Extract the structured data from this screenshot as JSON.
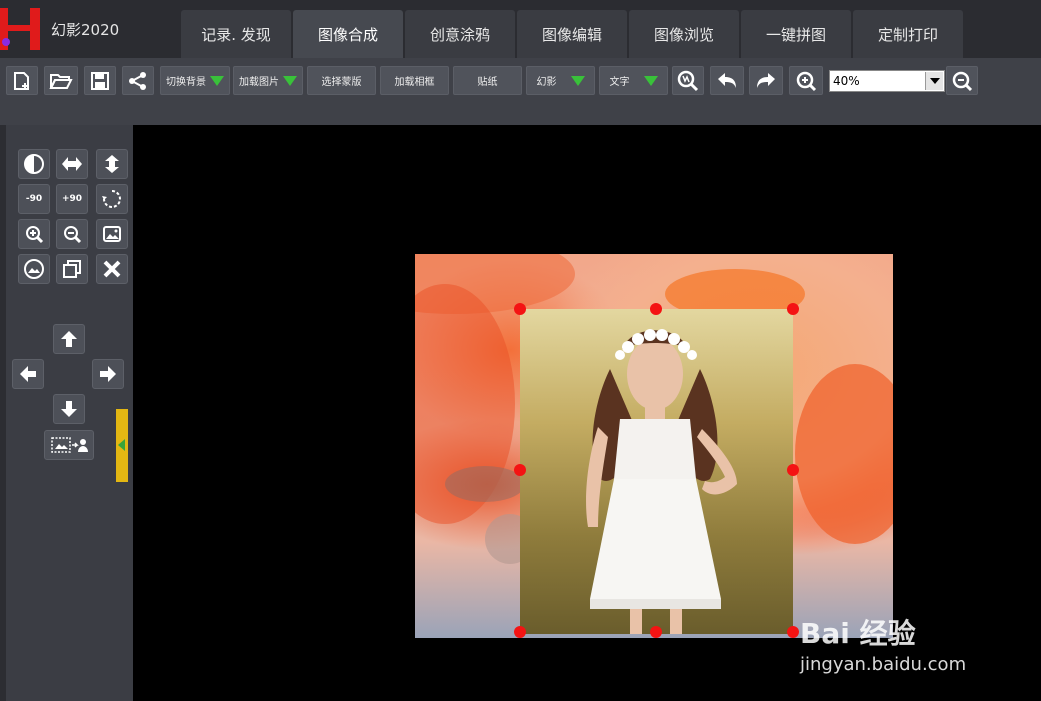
{
  "app": {
    "title": "幻影2020"
  },
  "tabs": [
    {
      "label": "记录. 发现"
    },
    {
      "label": "图像合成",
      "active": true
    },
    {
      "label": "创意涂鸦"
    },
    {
      "label": "图像编辑"
    },
    {
      "label": "图像浏览"
    },
    {
      "label": "一键拼图"
    },
    {
      "label": "定制打印"
    }
  ],
  "toolbar": {
    "switch_bg": "切换背景",
    "load_image": "加载图片",
    "select_template": "选择蒙版",
    "load_frame": "加载相框",
    "sticker": "贴纸",
    "phantom": "幻影",
    "text": "文字",
    "zoom": {
      "value": "40%"
    }
  },
  "left_panel": {
    "rotate_minus_label": "-90",
    "rotate_plus_label": "+90"
  },
  "watermark": {
    "brand": "Bai 经验",
    "url": "jingyan.baidu.com"
  },
  "colors": {
    "accent": "#e3b713",
    "handle": "#f41313",
    "dropdown_arrow": "#39c13a"
  }
}
